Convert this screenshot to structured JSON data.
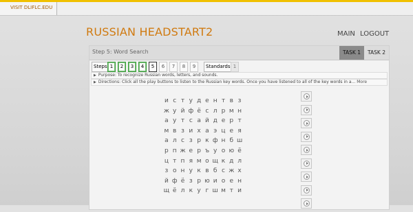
{
  "topbar": {
    "visit_link": "VISIT DLIFLC.EDU"
  },
  "header": {
    "title": "RUSSIAN HEADSTART2",
    "nav": [
      {
        "label": "MAIN"
      },
      {
        "label": "LOGOUT"
      }
    ]
  },
  "panel": {
    "step_title": "Step 5: Word Search",
    "tasks": [
      {
        "label": "TASK 1",
        "active": true
      },
      {
        "label": "TASK 2",
        "active": false
      }
    ],
    "steps_label": "Steps",
    "steps": [
      {
        "label": "1",
        "state": "done"
      },
      {
        "label": "2",
        "state": "done"
      },
      {
        "label": "3",
        "state": "done"
      },
      {
        "label": "4",
        "state": "done"
      },
      {
        "label": "5",
        "state": "current"
      },
      {
        "label": "6",
        "state": "plain"
      },
      {
        "label": "7",
        "state": "plain"
      },
      {
        "label": "8",
        "state": "plain"
      },
      {
        "label": "9",
        "state": "plain"
      }
    ],
    "standards_label": "Standards",
    "standards_count": "1",
    "purpose": "Purpose: To recognize Russian words, letters, and sounds.",
    "directions": "Directions: Click all the play buttons to listen to the Russian key words. Once you have listened to all of the key words in a...",
    "more_label": "More"
  },
  "word_search": {
    "rows": [
      [
        "и",
        "с",
        "т",
        "у",
        "д",
        "е",
        "н",
        "т",
        "в",
        "з"
      ],
      [
        "ж",
        "у",
        "й",
        "ф",
        "ё",
        "с",
        "л",
        "р",
        "м",
        "н"
      ],
      [
        "а",
        "у",
        "т",
        "с",
        "а",
        "й",
        "д",
        "е",
        "р",
        "т"
      ],
      [
        "м",
        "в",
        "з",
        "и",
        "х",
        "а",
        "э",
        "ц",
        "е",
        "я"
      ],
      [
        "а",
        "л",
        "с",
        "з",
        "р",
        "к",
        "ф",
        "н",
        "б",
        "ш"
      ],
      [
        "р",
        "п",
        "ж",
        "е",
        "р",
        "ъ",
        "у",
        "о",
        "ю",
        "ё"
      ],
      [
        "ц",
        "т",
        "п",
        "я",
        "м",
        "о",
        "щ",
        "к",
        "д",
        "л"
      ],
      [
        "з",
        "о",
        "н",
        "у",
        "к",
        "в",
        "б",
        "с",
        "ж",
        "х"
      ],
      [
        "й",
        "ф",
        "ё",
        "з",
        "р",
        "ю",
        "и",
        "о",
        "е",
        "н"
      ],
      [
        "щ",
        "ё",
        "л",
        "к",
        "у",
        "г",
        "ш",
        "м",
        "т",
        "и"
      ]
    ],
    "play_buttons": 9
  }
}
